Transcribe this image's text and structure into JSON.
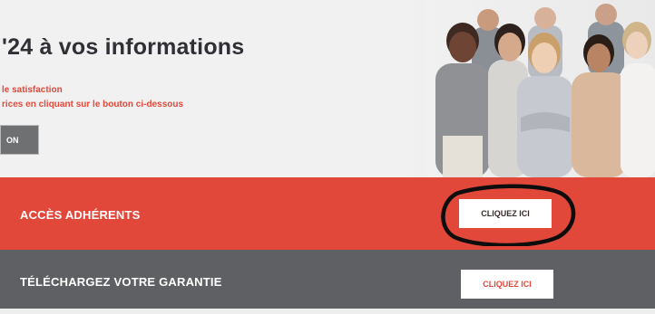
{
  "hero": {
    "title": "'24 à vos informations",
    "subtitle_line1": "le satisfaction",
    "subtitle_line2": "rices en cliquant sur le bouton ci-dessous",
    "button_label": "ON"
  },
  "members": {
    "label": "ACCÈS ADHÉRENTS",
    "button_label": "CLIQUEZ ICI"
  },
  "warranty": {
    "label": "TÉLÉCHARGEZ VOTRE GARANTIE",
    "button_label": "CLIQUEZ ICI"
  },
  "colors": {
    "accent_red": "#e2483a",
    "band_grey": "#5f6063",
    "title_dark": "#2f2f35"
  }
}
